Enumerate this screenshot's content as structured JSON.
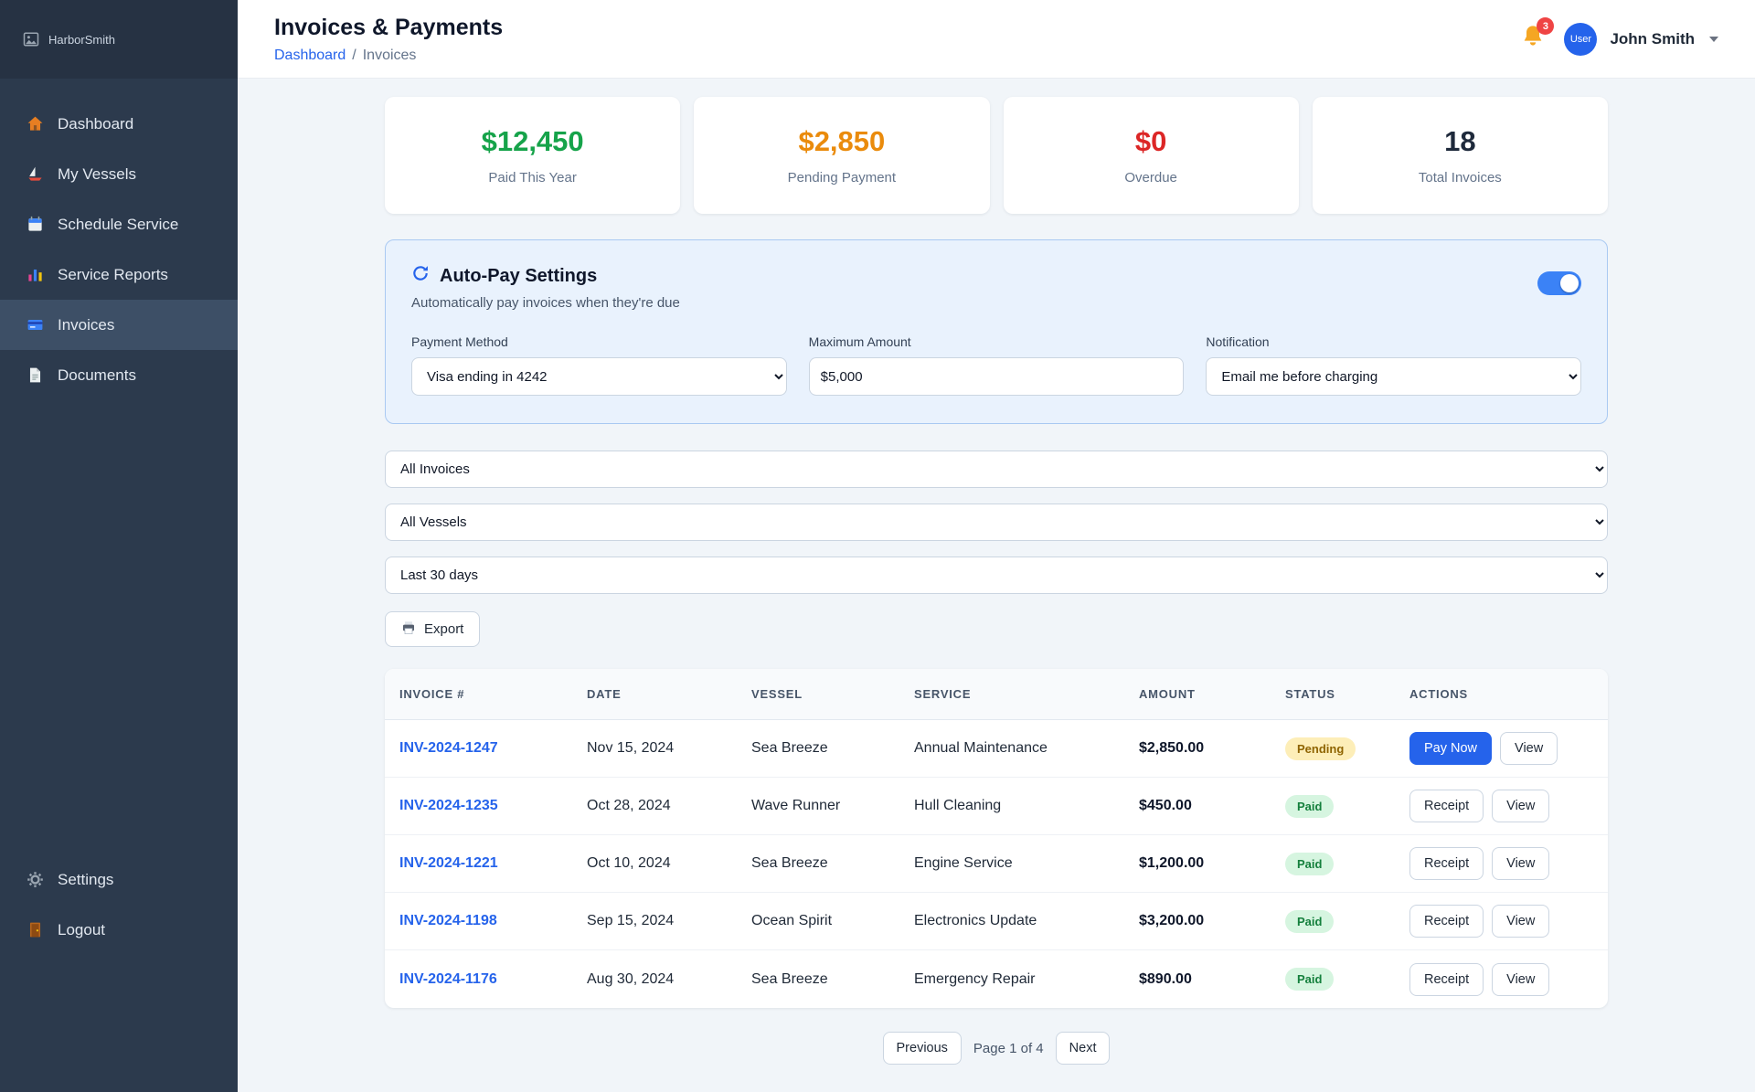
{
  "sidebar": {
    "logo_text": "HarborSmith",
    "items": [
      {
        "label": "Dashboard",
        "icon": "home-icon",
        "active": false
      },
      {
        "label": "My Vessels",
        "icon": "sailboat-icon",
        "active": false
      },
      {
        "label": "Schedule Service",
        "icon": "calendar-icon",
        "active": false
      },
      {
        "label": "Service Reports",
        "icon": "bar-chart-icon",
        "active": false
      },
      {
        "label": "Invoices",
        "icon": "credit-card-icon",
        "active": true
      },
      {
        "label": "Documents",
        "icon": "document-icon",
        "active": false
      }
    ],
    "footer_items": [
      {
        "label": "Settings",
        "icon": "gear-icon"
      },
      {
        "label": "Logout",
        "icon": "door-icon"
      }
    ]
  },
  "header": {
    "title": "Invoices & Payments",
    "breadcrumb": {
      "parent": "Dashboard",
      "separator": "/",
      "current": "Invoices"
    },
    "notification_count": "3",
    "bell_icon": "bell-icon",
    "user": {
      "name": "John Smith",
      "avatar_text": "User"
    }
  },
  "stats": [
    {
      "value": "$12,450",
      "label": "Paid This Year",
      "color": "#16a34a"
    },
    {
      "value": "$2,850",
      "label": "Pending Payment",
      "color": "#ea8b0c"
    },
    {
      "value": "$0",
      "label": "Overdue",
      "color": "#dc2626"
    },
    {
      "value": "18",
      "label": "Total Invoices",
      "color": "#1e293b"
    }
  ],
  "autopay": {
    "icon": "refresh-icon",
    "title": "Auto-Pay Settings",
    "subtitle": "Automatically pay invoices when they're due",
    "toggle_on": true,
    "fields": {
      "payment_method": {
        "label": "Payment Method",
        "value": "Visa ending in 4242"
      },
      "maximum_amount": {
        "label": "Maximum Amount",
        "value": "$5,000"
      },
      "notification": {
        "label": "Notification",
        "value": "Email me before charging"
      }
    }
  },
  "filters": {
    "invoice_select_value": "All Invoices",
    "vessel_select_value": "All Vessels",
    "date_select_value": "Last 30 days",
    "export_label": "Export",
    "export_icon": "printer-icon"
  },
  "invoice_table": {
    "columns": [
      "INVOICE #",
      "DATE",
      "VESSEL",
      "SERVICE",
      "AMOUNT",
      "STATUS",
      "ACTIONS"
    ],
    "rows": [
      {
        "invoice_number": "INV-2024-1247",
        "date": "Nov 15, 2024",
        "vessel": "Sea Breeze",
        "service": "Annual Maintenance",
        "amount": "$2,850.00",
        "status": "Pending",
        "actions": [
          {
            "label": "Pay Now",
            "variant": "primary"
          },
          {
            "label": "View",
            "variant": "default"
          }
        ]
      },
      {
        "invoice_number": "INV-2024-1235",
        "date": "Oct 28, 2024",
        "vessel": "Wave Runner",
        "service": "Hull Cleaning",
        "amount": "$450.00",
        "status": "Paid",
        "actions": [
          {
            "label": "Receipt",
            "variant": "default"
          },
          {
            "label": "View",
            "variant": "default"
          }
        ]
      },
      {
        "invoice_number": "INV-2024-1221",
        "date": "Oct 10, 2024",
        "vessel": "Sea Breeze",
        "service": "Engine Service",
        "amount": "$1,200.00",
        "status": "Paid",
        "actions": [
          {
            "label": "Receipt",
            "variant": "default"
          },
          {
            "label": "View",
            "variant": "default"
          }
        ]
      },
      {
        "invoice_number": "INV-2024-1198",
        "date": "Sep 15, 2024",
        "vessel": "Ocean Spirit",
        "service": "Electronics Update",
        "amount": "$3,200.00",
        "status": "Paid",
        "actions": [
          {
            "label": "Receipt",
            "variant": "default"
          },
          {
            "label": "View",
            "variant": "default"
          }
        ]
      },
      {
        "invoice_number": "INV-2024-1176",
        "date": "Aug 30, 2024",
        "vessel": "Sea Breeze",
        "service": "Emergency Repair",
        "amount": "$890.00",
        "status": "Paid",
        "actions": [
          {
            "label": "Receipt",
            "variant": "default"
          },
          {
            "label": "View",
            "variant": "default"
          }
        ]
      }
    ]
  },
  "pagination": {
    "previous_label": "Previous",
    "page_status": "Page 1 of 4",
    "next_label": "Next"
  },
  "colors": {
    "accent_blue": "#2563eb",
    "sidebar_bg": "#2c3a4d",
    "page_bg": "#f1f5f9",
    "pending_badge_bg": "#fdeeb8",
    "pending_badge_text": "#8f6400",
    "paid_badge_bg": "#d6f5e0",
    "paid_badge_text": "#15803d"
  }
}
